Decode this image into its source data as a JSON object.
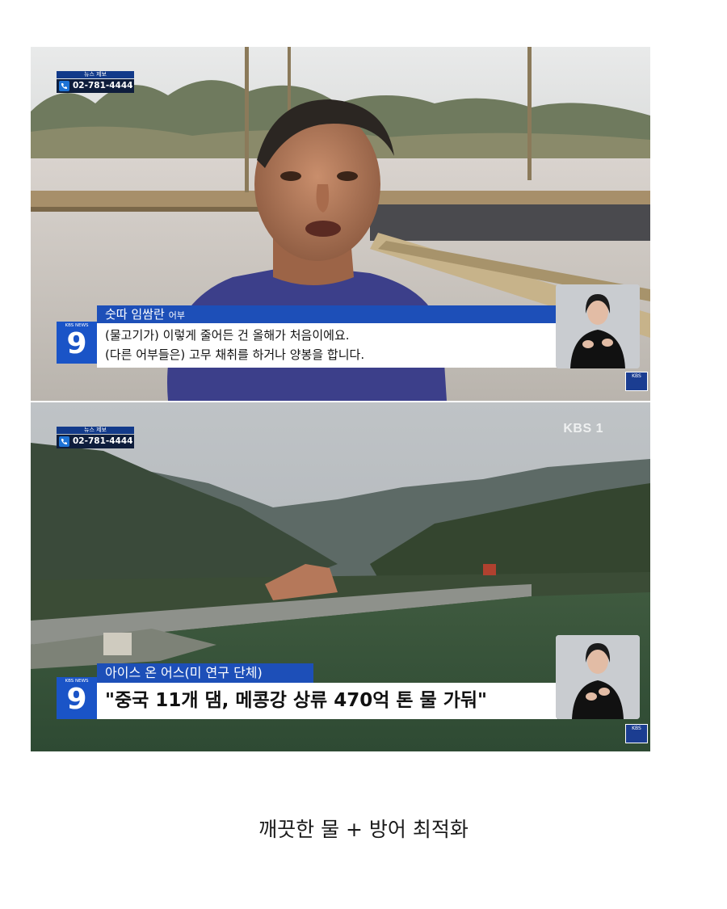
{
  "frame1": {
    "hotline_label": "뉴스 제보",
    "hotline_number": "02-781-4444",
    "logo_small": "KBS NEWS",
    "logo_number": "9",
    "speaker_name": "숫따 임쌈란",
    "speaker_role": "어부",
    "caption_line1": "(물고기가) 이렇게 줄어든 건 올해가 처음이에요.",
    "caption_line2": "(다른 어부들은) 고무 채취를 하거나 양봉을 합니다.",
    "corner_logo": "KBS"
  },
  "frame2": {
    "hotline_label": "뉴스 제보",
    "hotline_number": "02-781-4444",
    "watermark": "KBS 1",
    "logo_small": "KBS NEWS",
    "logo_number": "9",
    "source_label": "아이스 온 어스(미 연구 단체)",
    "headline": "\"중국 11개 댐, 메콩강 상류 470억 톤 물 가둬\"",
    "corner_logo": "KBS"
  },
  "caption": "깨끗한 물 + 방어 최적화"
}
